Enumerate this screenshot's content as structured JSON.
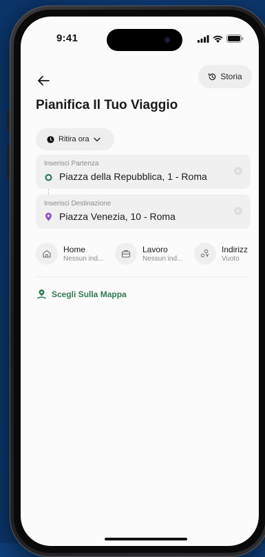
{
  "status_bar": {
    "time": "9:41"
  },
  "header": {
    "history_label": "Storia",
    "title": "Pianifica Il Tuo Viaggio"
  },
  "pickup": {
    "label": "Ritira ora"
  },
  "departure": {
    "label": "Inserisci Partenza",
    "value": "Piazza della Repubblica, 1 - Roma"
  },
  "destination": {
    "label": "Inserisci Destinazione",
    "value": "Piazza Venezia, 10 - Roma"
  },
  "shortcuts": [
    {
      "title": "Home",
      "subtitle": "Nessun ind...",
      "icon": "home-icon"
    },
    {
      "title": "Lavoro",
      "subtitle": "Nessun ind...",
      "icon": "briefcase-icon"
    },
    {
      "title": "Indirizz",
      "subtitle": "Vuoto",
      "icon": "saved-places-icon"
    }
  ],
  "map_link": {
    "label": "Scegli Sulla Mappa"
  },
  "colors": {
    "accent_green": "#2f7a52",
    "destination_purple": "#8a4fd1",
    "background": "#0d3e78"
  }
}
